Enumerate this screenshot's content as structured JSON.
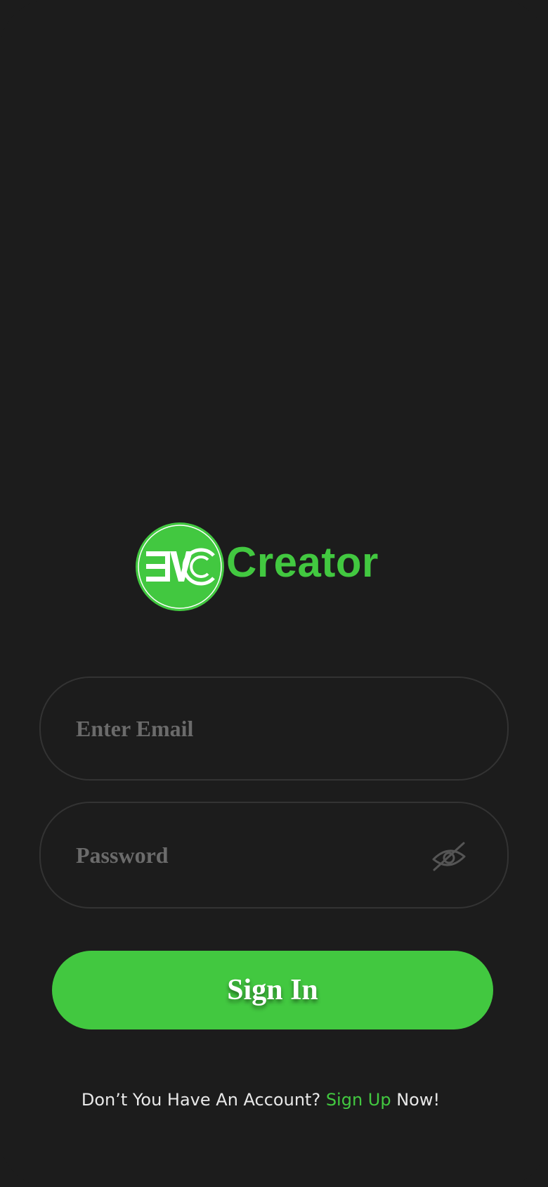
{
  "brand": {
    "logo_badge_text": "EVC",
    "logo_word": "Creator",
    "accent_color": "#42c840"
  },
  "form": {
    "email_placeholder": "Enter Email",
    "email_value": "",
    "password_placeholder": "Password",
    "password_value": "",
    "password_toggle_icon": "eye-off-icon",
    "signin_label": "Sign In"
  },
  "footer": {
    "prompt": "Don’t You Have An Account? ",
    "signup_link": "Sign Up",
    "suffix": " Now!"
  }
}
